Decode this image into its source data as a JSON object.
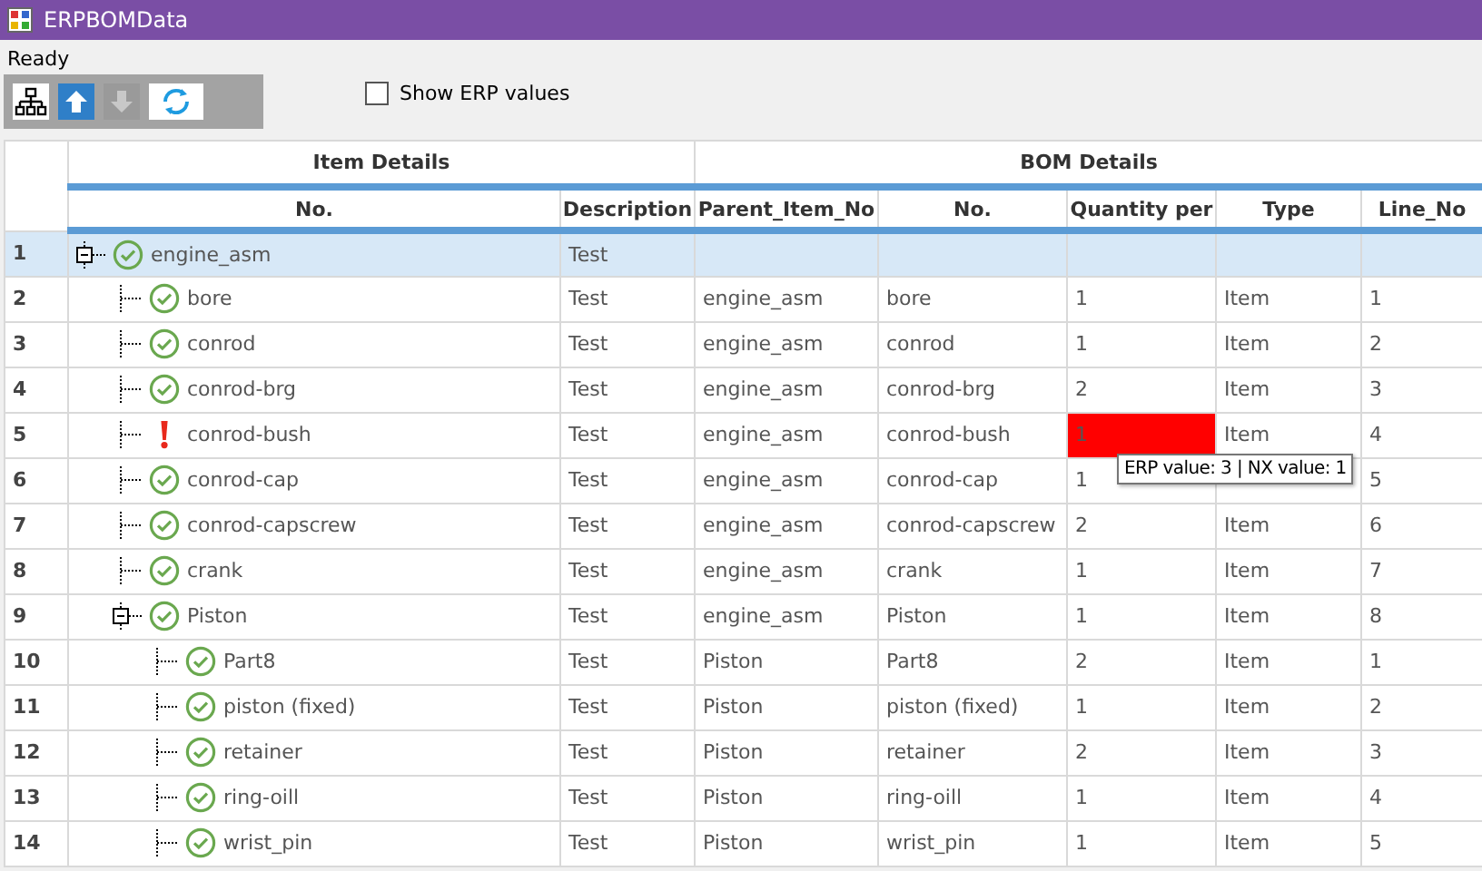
{
  "window": {
    "title": "ERPBOMData"
  },
  "status": "Ready",
  "toolbar": [
    {
      "kind": "hierarchy",
      "disabled": false
    },
    {
      "kind": "up",
      "disabled": false
    },
    {
      "kind": "down",
      "disabled": true
    },
    {
      "kind": "refresh",
      "disabled": false
    }
  ],
  "show_erp_values": {
    "label": "Show ERP values",
    "checked": false
  },
  "column_groups": [
    {
      "label": "Item Details"
    },
    {
      "label": "BOM Details"
    }
  ],
  "columns": [
    "No.",
    "Description",
    "Parent_Item_No",
    "No.",
    "Quantity per",
    "Type",
    "Line_No"
  ],
  "rows": [
    {
      "row_number": "1",
      "no": "engine_asm",
      "kind": "ok",
      "description": "Test",
      "selected": true,
      "expanded": true,
      "children": [
        {
          "row_number": "2",
          "no": "bore",
          "kind": "ok",
          "description": "Test",
          "parent_item_no": "engine_asm",
          "bom_no": "bore",
          "quantity": "1",
          "mismatch": false,
          "type": "Item",
          "line_no": "1",
          "selected": false
        },
        {
          "row_number": "3",
          "no": "conrod",
          "kind": "ok",
          "description": "Test",
          "parent_item_no": "engine_asm",
          "bom_no": "conrod",
          "quantity": "1",
          "mismatch": false,
          "type": "Item",
          "line_no": "2",
          "selected": false
        },
        {
          "row_number": "4",
          "no": "conrod-brg",
          "kind": "ok",
          "description": "Test",
          "parent_item_no": "engine_asm",
          "bom_no": "conrod-brg",
          "quantity": "2",
          "mismatch": false,
          "type": "Item",
          "line_no": "3",
          "selected": false
        },
        {
          "row_number": "5",
          "no": "conrod-bush",
          "kind": "error",
          "description": "Test",
          "parent_item_no": "engine_asm",
          "bom_no": "conrod-bush",
          "quantity": "1",
          "mismatch": true,
          "type": "Item",
          "line_no": "4",
          "selected": false
        },
        {
          "row_number": "6",
          "no": "conrod-cap",
          "kind": "ok",
          "description": "Test",
          "parent_item_no": "engine_asm",
          "bom_no": "conrod-cap",
          "quantity": "1",
          "mismatch": false,
          "line_no": "5",
          "selected": false
        },
        {
          "row_number": "7",
          "no": "conrod-capscrew",
          "kind": "ok",
          "description": "Test",
          "parent_item_no": "engine_asm",
          "bom_no": "conrod-capscrew",
          "quantity": "2",
          "mismatch": false,
          "type": "Item",
          "line_no": "6",
          "selected": false
        },
        {
          "row_number": "8",
          "no": "crank",
          "kind": "ok",
          "description": "Test",
          "parent_item_no": "engine_asm",
          "bom_no": "crank",
          "quantity": "1",
          "mismatch": false,
          "type": "Item",
          "line_no": "7",
          "selected": false
        },
        {
          "row_number": "9",
          "no": "Piston",
          "kind": "ok",
          "description": "Test",
          "parent_item_no": "engine_asm",
          "bom_no": "Piston",
          "quantity": "1",
          "mismatch": false,
          "type": "Item",
          "line_no": "8",
          "selected": false,
          "expanded": true,
          "children": [
            {
              "row_number": "10",
              "no": "Part8",
              "kind": "ok",
              "description": "Test",
              "parent_item_no": "Piston",
              "bom_no": "Part8",
              "quantity": "2",
              "mismatch": false,
              "type": "Item",
              "line_no": "1",
              "selected": false
            },
            {
              "row_number": "11",
              "no": "piston (fixed)",
              "kind": "ok",
              "description": "Test",
              "parent_item_no": "Piston",
              "bom_no": "piston (fixed)",
              "quantity": "1",
              "mismatch": false,
              "type": "Item",
              "line_no": "2",
              "selected": false
            },
            {
              "row_number": "12",
              "no": "retainer",
              "kind": "ok",
              "description": "Test",
              "parent_item_no": "Piston",
              "bom_no": "retainer",
              "quantity": "2",
              "mismatch": false,
              "type": "Item",
              "line_no": "3",
              "selected": false
            },
            {
              "row_number": "13",
              "no": "ring-oill",
              "kind": "ok",
              "description": "Test",
              "parent_item_no": "Piston",
              "bom_no": "ring-oill",
              "quantity": "1",
              "mismatch": false,
              "type": "Item",
              "line_no": "4",
              "selected": false
            },
            {
              "row_number": "14",
              "no": "wrist_pin",
              "kind": "ok",
              "description": "Test",
              "parent_item_no": "Piston",
              "bom_no": "wrist_pin",
              "quantity": "1",
              "mismatch": false,
              "type": "Item",
              "line_no": "5",
              "selected": false
            }
          ]
        }
      ]
    }
  ],
  "tooltip": "ERP value: 3 | NX value: 1"
}
